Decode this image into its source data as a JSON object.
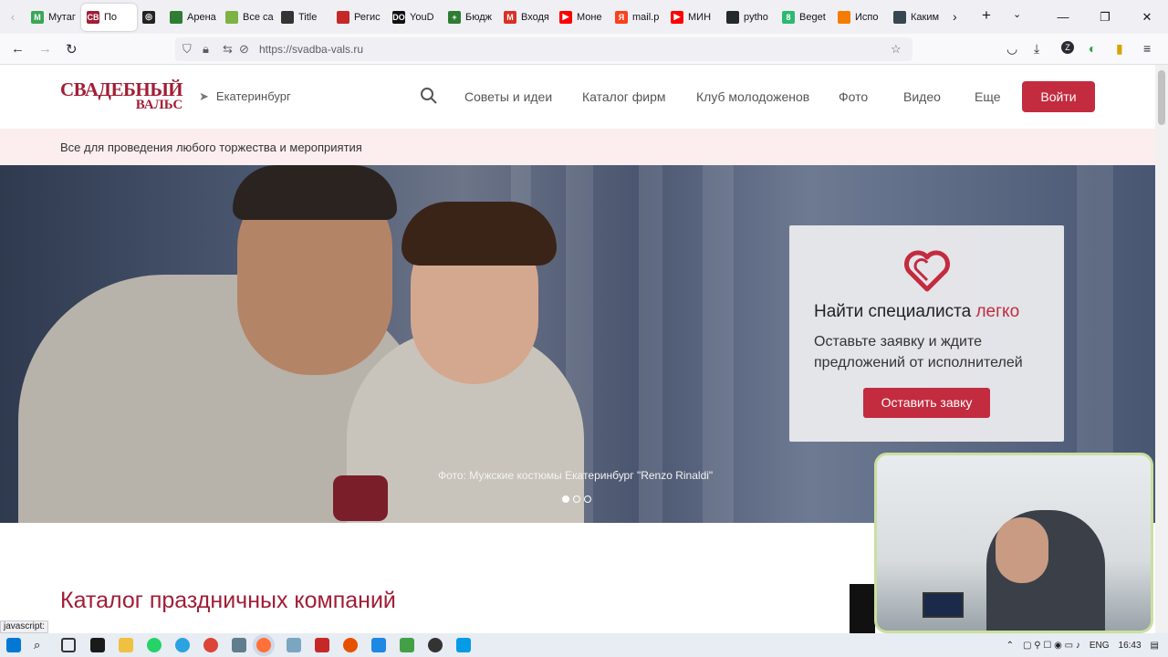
{
  "browser": {
    "tabs": [
      {
        "label": "Мутаг",
        "color": "#3aa757",
        "glyph": "M"
      },
      {
        "label": "По",
        "color": "#a11d35",
        "glyph": "СВ",
        "active": true
      },
      {
        "label": "",
        "color": "#222222",
        "glyph": "◎"
      },
      {
        "label": "Арена",
        "color": "#2e7d32",
        "glyph": ""
      },
      {
        "label": "Все са",
        "color": "#7cb342",
        "glyph": ""
      },
      {
        "label": "Title",
        "color": "#333333",
        "glyph": ""
      },
      {
        "label": "Регис",
        "color": "#c62828",
        "glyph": ""
      },
      {
        "label": "YouD",
        "color": "#111111",
        "glyph": "DO"
      },
      {
        "label": "Бюдж",
        "color": "#2e7d32",
        "glyph": "+"
      },
      {
        "label": "Входя",
        "color": "#d93025",
        "glyph": "M"
      },
      {
        "label": "Моне",
        "color": "#ff0000",
        "glyph": "▶"
      },
      {
        "label": "mail.p",
        "color": "#fc3f1d",
        "glyph": "Я"
      },
      {
        "label": "МИН",
        "color": "#ff0000",
        "glyph": "▶"
      },
      {
        "label": "pytho",
        "color": "#24292e",
        "glyph": ""
      },
      {
        "label": "Beget",
        "color": "#2eb872",
        "glyph": "8"
      },
      {
        "label": "Испо",
        "color": "#f57c00",
        "glyph": ""
      },
      {
        "label": "Каким",
        "color": "#37474f",
        "glyph": ""
      }
    ],
    "url": "https://svadba-vals.ru",
    "status_text": "javascript:"
  },
  "site": {
    "logo_line1": "СВАДЕБНЫЙ",
    "logo_line2": "ВАЛЬС",
    "city": "Екатеринбург",
    "menu": [
      "Советы и идеи",
      "Каталог фирм",
      "Клуб молодоженов",
      "Фото",
      "Видео",
      "Еще"
    ],
    "login_label": "Войти",
    "tagline": "Все для проведения любого торжества и мероприятия",
    "card_title": "Найти специалиста",
    "card_title_accent": "легко",
    "card_text": "Оставьте заявку и ждите предложений от исполнителей",
    "card_button": "Оставить завку",
    "hero_caption": "Фото: Мужские костюмы Екатеринбург \"Renzo Rinaldi\"",
    "slides": 3,
    "active_slide": 1,
    "catalog_title": "Каталог праздничных компаний",
    "accent_color": "#c32b3f",
    "brand_color": "#a11d35"
  },
  "taskbar": {
    "lang": "ENG",
    "time": "16:43"
  }
}
